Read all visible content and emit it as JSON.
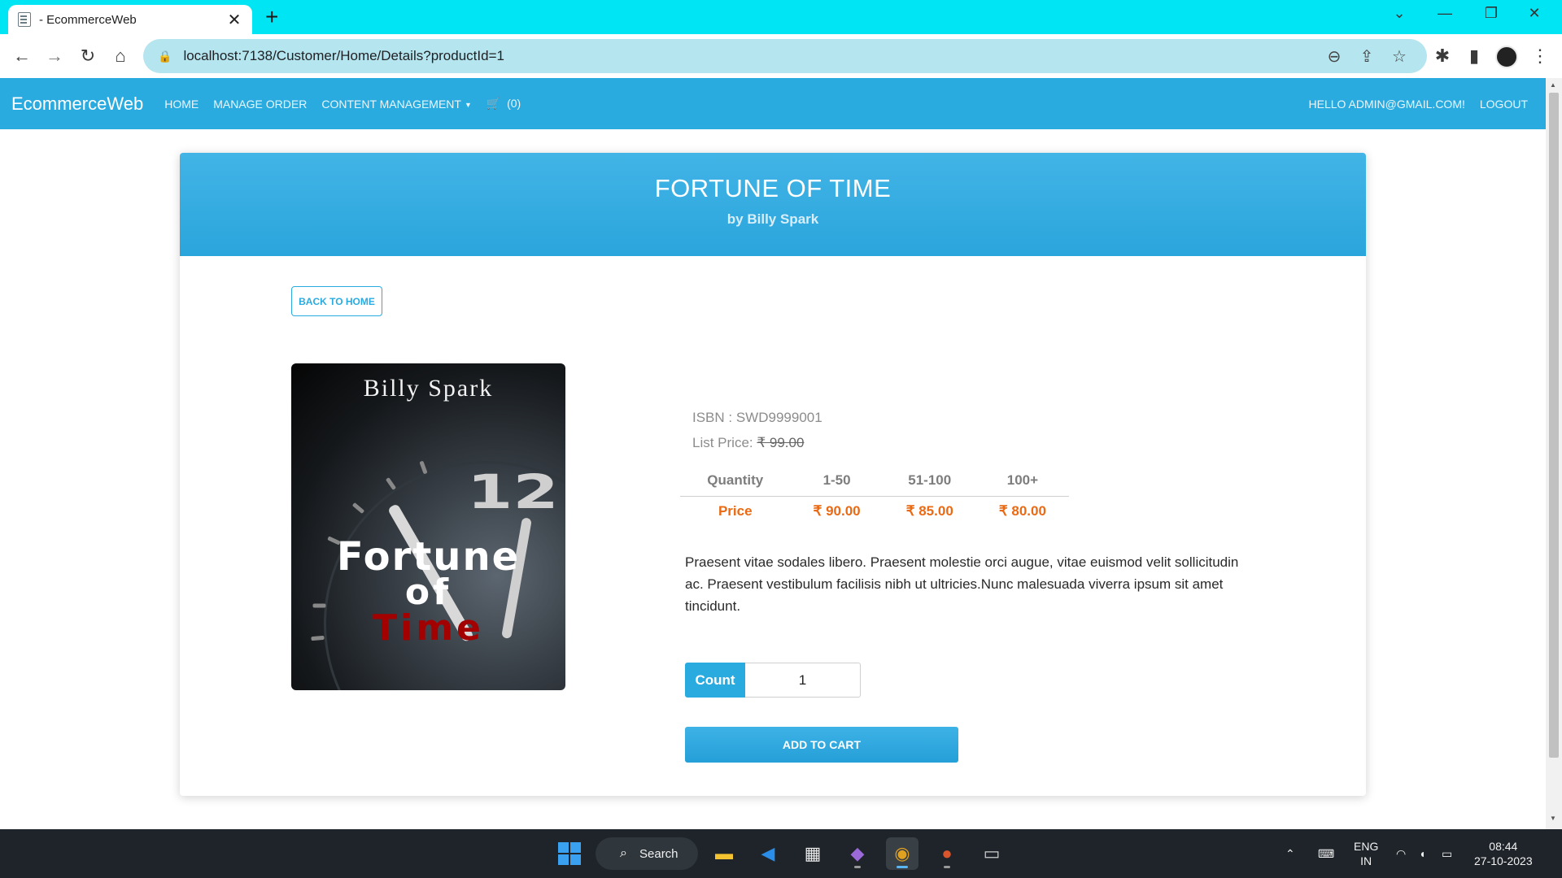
{
  "browser": {
    "tab_title": "- EcommerceWeb",
    "tab_close": "✕",
    "new_tab": "+",
    "url": "localhost:7138/Customer/Home/Details?productId=1"
  },
  "navbar": {
    "brand": "EcommerceWeb",
    "links": [
      "HOME",
      "MANAGE ORDER",
      "CONTENT MANAGEMENT"
    ],
    "cart_count": "(0)",
    "greeting": "HELLO ADMIN@GMAIL.COM!",
    "logout": "LOGOUT"
  },
  "product": {
    "title": "FORTUNE OF TIME",
    "author_line": "by Billy Spark",
    "back_button": "BACK TO HOME",
    "cover": {
      "author": "Billy Spark",
      "title_line1": "Fortune",
      "title_line2": "of",
      "title_line3": "Time",
      "clock_number": "12"
    },
    "isbn": "ISBN : SWD9999001",
    "list_price_label": "List Price: ",
    "list_price_value": "₹ 99.00",
    "price_table": {
      "headers": [
        "Quantity",
        "1-50",
        "51-100",
        "100+"
      ],
      "row_label": "Price",
      "prices": [
        "₹ 90.00",
        "₹ 85.00",
        "₹ 80.00"
      ]
    },
    "description": "Praesent vitae sodales libero. Praesent molestie orci augue, vitae euismod velit sollicitudin ac. Praesent vestibulum facilisis nibh ut ultricies.Nunc malesuada viverra ipsum sit amet tincidunt.",
    "count_label": "Count",
    "count_value": "1",
    "add_to_cart": "ADD TO CART"
  },
  "taskbar": {
    "search_label": "Search",
    "language_line1": "ENG",
    "language_line2": "IN",
    "time": "08:44",
    "date": "27-10-2023"
  },
  "colors": {
    "tabbar": "#00e5f4",
    "navbar": "#2aabe0",
    "price_orange": "#ea6a14",
    "taskbar": "#1e2429"
  }
}
